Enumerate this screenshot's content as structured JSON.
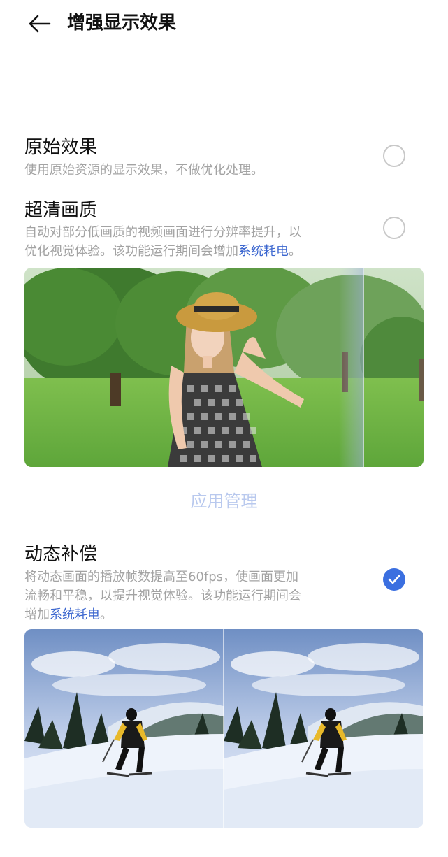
{
  "header": {
    "title": "增强显示效果"
  },
  "options": [
    {
      "title": "原始效果",
      "desc": "使用原始资源的显示效果，不做优化处理。",
      "selected": false
    },
    {
      "title": "超清画质",
      "desc_line1": "自动对部分低画质的视频画面进行分辨率提升，以",
      "desc_line2_prefix": "优化视觉体验。该功能运行期间会增加",
      "desc_link": "系统耗电",
      "desc_line2_suffix": "。",
      "selected": false
    },
    {
      "title": "动态补偿",
      "desc_line1": "将动态画面的播放帧数提高至60fps，使画面更加",
      "desc_line2": "流畅和平稳，以提升视觉体验。该功能运行期间会",
      "desc_line3_prefix": "增加",
      "desc_link": "系统耗电",
      "desc_line3_suffix": "。",
      "selected": true
    }
  ],
  "app_manage_label": "应用管理",
  "colors": {
    "accent": "#3b6fe0",
    "link": "#3b66cf"
  }
}
